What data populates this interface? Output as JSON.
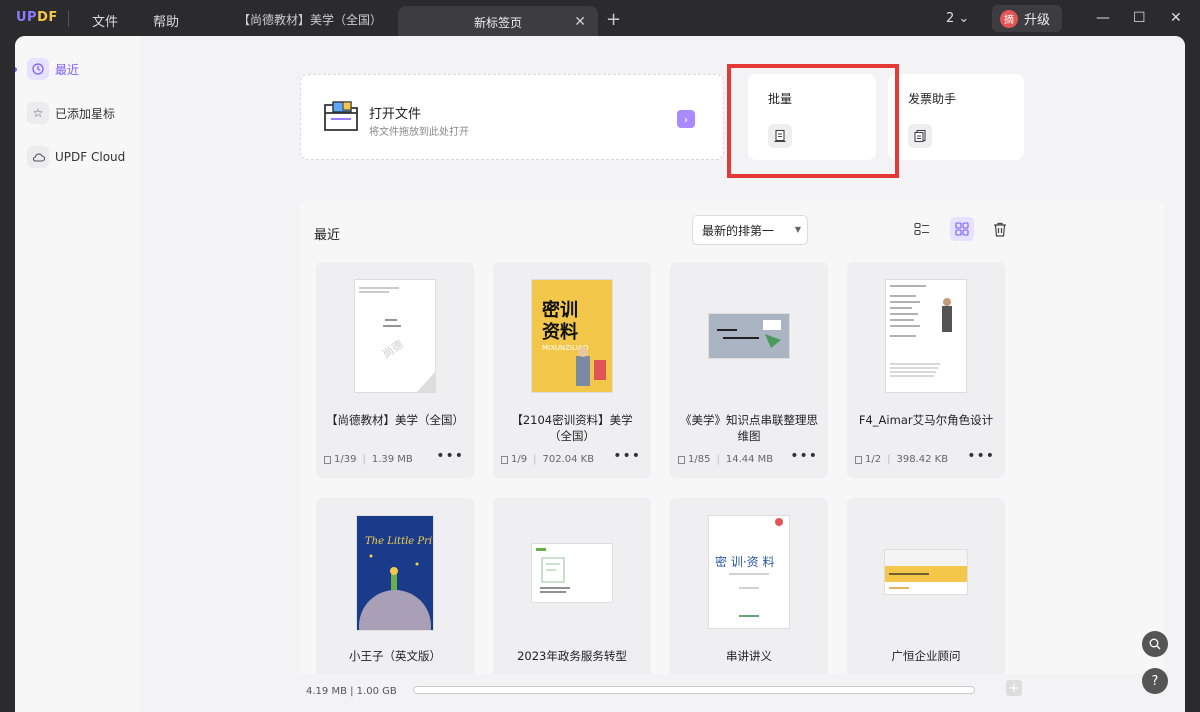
{
  "titlebar": {
    "logo_a": "UP",
    "logo_b": "DF",
    "menu_file": "文件",
    "menu_help": "帮助",
    "tab_inactive": "【尚德教材】美学（全国）",
    "tab_active": "新标签页",
    "page_count": "2",
    "avatar_char": "摘",
    "upgrade_label": "升级"
  },
  "sidebar": {
    "items": [
      {
        "label": "最近",
        "icon": "clock-icon"
      },
      {
        "label": "已添加星标",
        "icon": "star-icon"
      },
      {
        "label": "UPDF Cloud",
        "icon": "cloud-icon"
      }
    ]
  },
  "open_file": {
    "title": "打开文件",
    "subtitle": "将文件拖放到此处打开"
  },
  "tools": {
    "batch": "批量",
    "invoice": "发票助手"
  },
  "recent": {
    "title": "最近",
    "sort_value": "最新的排第一"
  },
  "files": [
    {
      "name": "【尚德教材】美学（全国）",
      "pages": "1/39",
      "size": "1.39 MB"
    },
    {
      "name": "【2104密训资料】美学（全国）",
      "pages": "1/9",
      "size": "702.04 KB"
    },
    {
      "name": "《美学》知识点串联整理思维图",
      "pages": "1/85",
      "size": "14.44 MB"
    },
    {
      "name": "F4_Aimar艾马尔角色设计",
      "pages": "1/2",
      "size": "398.42 KB"
    },
    {
      "name": "小王子（英文版）",
      "pages": "",
      "size": ""
    },
    {
      "name": "2023年政务服务转型",
      "pages": "",
      "size": ""
    },
    {
      "name": "串讲讲义",
      "pages": "",
      "size": ""
    },
    {
      "name": "广恒企业顾问",
      "pages": "",
      "size": ""
    }
  ],
  "thumb_text": {
    "mixun_a": "密训",
    "mixun_b": "资料",
    "mixun_c": "MIXUNZILIAO",
    "little_prince": "The Little Prince",
    "chuanjiang": "密 训·资 料"
  },
  "storage": {
    "text": "4.19 MB | 1.00 GB",
    "used_fraction": 0.004
  },
  "colors": {
    "accent": "#7b5cff",
    "highlight": "#e53935"
  }
}
